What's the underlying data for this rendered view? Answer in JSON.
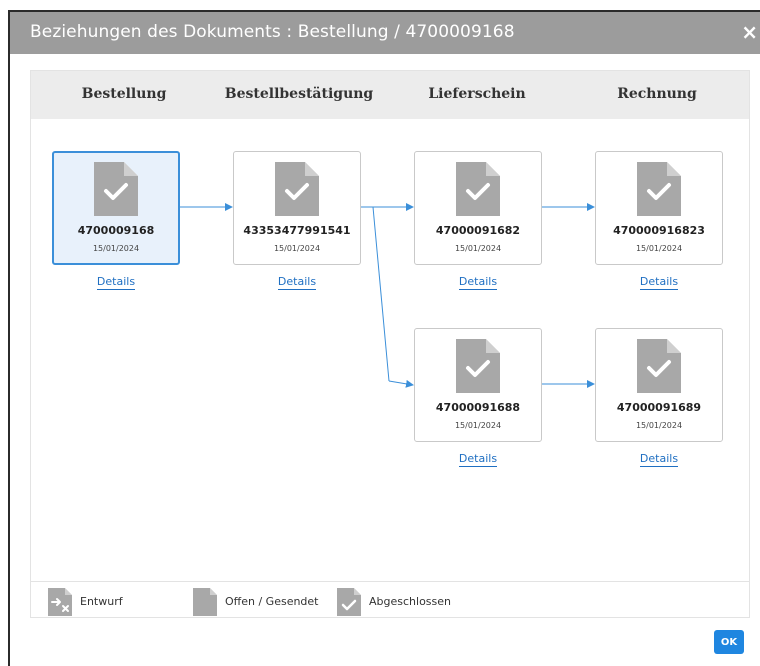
{
  "dialog": {
    "title": "Beziehungen des Dokuments : Bestellung / 4700009168",
    "close_label": "×",
    "ok_label": "OK"
  },
  "columns": [
    "Bestellung",
    "Bestellbestätigung",
    "Lieferschein",
    "Rechnung"
  ],
  "documents": [
    {
      "number": "4700009168",
      "date": "15/01/2024",
      "details": "Details",
      "status": "abgeschlossen",
      "selected": true
    },
    {
      "number": "43353477991541",
      "date": "15/01/2024",
      "details": "Details",
      "status": "abgeschlossen"
    },
    {
      "number": "47000091682",
      "date": "15/01/2024",
      "details": "Details",
      "status": "abgeschlossen"
    },
    {
      "number": "470000916823",
      "date": "15/01/2024",
      "details": "Details",
      "status": "abgeschlossen"
    },
    {
      "number": "47000091688",
      "date": "15/01/2024",
      "details": "Details",
      "status": "abgeschlossen"
    },
    {
      "number": "47000091689",
      "date": "15/01/2024",
      "details": "Details",
      "status": "abgeschlossen"
    }
  ],
  "legend": [
    {
      "label": "Entwurf",
      "icon": "document-draft-icon"
    },
    {
      "label": "Offen / Gesendet",
      "icon": "document-open-icon"
    },
    {
      "label": "Abgeschlossen",
      "icon": "document-completed-icon"
    }
  ],
  "colors": {
    "titlebar": "#9c9c9c",
    "header_bg": "#ececec",
    "selected_border": "#3b8fd9",
    "selected_bg": "#e8f1fb",
    "link": "#1f6fc2",
    "connector": "#3b8fd9",
    "icon_gray": "#a8a8a8",
    "ok_button": "#1f86e0"
  }
}
